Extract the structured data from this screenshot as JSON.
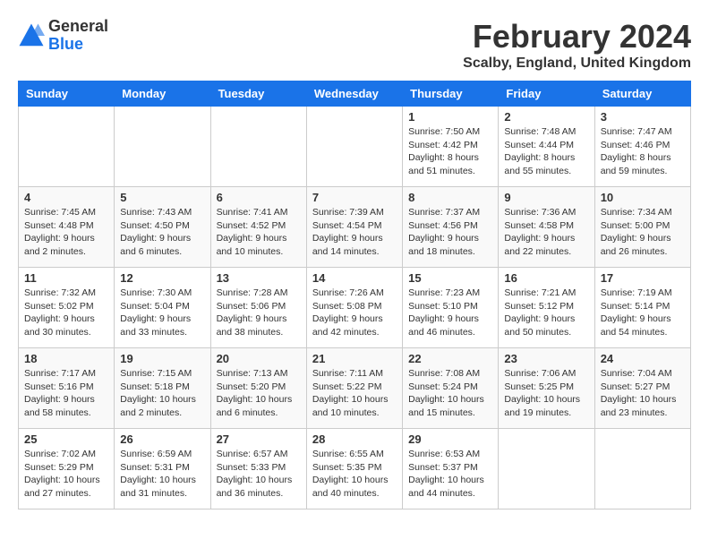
{
  "logo": {
    "general": "General",
    "blue": "Blue"
  },
  "title": "February 2024",
  "subtitle": "Scalby, England, United Kingdom",
  "days_of_week": [
    "Sunday",
    "Monday",
    "Tuesday",
    "Wednesday",
    "Thursday",
    "Friday",
    "Saturday"
  ],
  "weeks": [
    [
      {
        "day": "",
        "info": ""
      },
      {
        "day": "",
        "info": ""
      },
      {
        "day": "",
        "info": ""
      },
      {
        "day": "",
        "info": ""
      },
      {
        "day": "1",
        "info": "Sunrise: 7:50 AM\nSunset: 4:42 PM\nDaylight: 8 hours\nand 51 minutes."
      },
      {
        "day": "2",
        "info": "Sunrise: 7:48 AM\nSunset: 4:44 PM\nDaylight: 8 hours\nand 55 minutes."
      },
      {
        "day": "3",
        "info": "Sunrise: 7:47 AM\nSunset: 4:46 PM\nDaylight: 8 hours\nand 59 minutes."
      }
    ],
    [
      {
        "day": "4",
        "info": "Sunrise: 7:45 AM\nSunset: 4:48 PM\nDaylight: 9 hours\nand 2 minutes."
      },
      {
        "day": "5",
        "info": "Sunrise: 7:43 AM\nSunset: 4:50 PM\nDaylight: 9 hours\nand 6 minutes."
      },
      {
        "day": "6",
        "info": "Sunrise: 7:41 AM\nSunset: 4:52 PM\nDaylight: 9 hours\nand 10 minutes."
      },
      {
        "day": "7",
        "info": "Sunrise: 7:39 AM\nSunset: 4:54 PM\nDaylight: 9 hours\nand 14 minutes."
      },
      {
        "day": "8",
        "info": "Sunrise: 7:37 AM\nSunset: 4:56 PM\nDaylight: 9 hours\nand 18 minutes."
      },
      {
        "day": "9",
        "info": "Sunrise: 7:36 AM\nSunset: 4:58 PM\nDaylight: 9 hours\nand 22 minutes."
      },
      {
        "day": "10",
        "info": "Sunrise: 7:34 AM\nSunset: 5:00 PM\nDaylight: 9 hours\nand 26 minutes."
      }
    ],
    [
      {
        "day": "11",
        "info": "Sunrise: 7:32 AM\nSunset: 5:02 PM\nDaylight: 9 hours\nand 30 minutes."
      },
      {
        "day": "12",
        "info": "Sunrise: 7:30 AM\nSunset: 5:04 PM\nDaylight: 9 hours\nand 33 minutes."
      },
      {
        "day": "13",
        "info": "Sunrise: 7:28 AM\nSunset: 5:06 PM\nDaylight: 9 hours\nand 38 minutes."
      },
      {
        "day": "14",
        "info": "Sunrise: 7:26 AM\nSunset: 5:08 PM\nDaylight: 9 hours\nand 42 minutes."
      },
      {
        "day": "15",
        "info": "Sunrise: 7:23 AM\nSunset: 5:10 PM\nDaylight: 9 hours\nand 46 minutes."
      },
      {
        "day": "16",
        "info": "Sunrise: 7:21 AM\nSunset: 5:12 PM\nDaylight: 9 hours\nand 50 minutes."
      },
      {
        "day": "17",
        "info": "Sunrise: 7:19 AM\nSunset: 5:14 PM\nDaylight: 9 hours\nand 54 minutes."
      }
    ],
    [
      {
        "day": "18",
        "info": "Sunrise: 7:17 AM\nSunset: 5:16 PM\nDaylight: 9 hours\nand 58 minutes."
      },
      {
        "day": "19",
        "info": "Sunrise: 7:15 AM\nSunset: 5:18 PM\nDaylight: 10 hours\nand 2 minutes."
      },
      {
        "day": "20",
        "info": "Sunrise: 7:13 AM\nSunset: 5:20 PM\nDaylight: 10 hours\nand 6 minutes."
      },
      {
        "day": "21",
        "info": "Sunrise: 7:11 AM\nSunset: 5:22 PM\nDaylight: 10 hours\nand 10 minutes."
      },
      {
        "day": "22",
        "info": "Sunrise: 7:08 AM\nSunset: 5:24 PM\nDaylight: 10 hours\nand 15 minutes."
      },
      {
        "day": "23",
        "info": "Sunrise: 7:06 AM\nSunset: 5:25 PM\nDaylight: 10 hours\nand 19 minutes."
      },
      {
        "day": "24",
        "info": "Sunrise: 7:04 AM\nSunset: 5:27 PM\nDaylight: 10 hours\nand 23 minutes."
      }
    ],
    [
      {
        "day": "25",
        "info": "Sunrise: 7:02 AM\nSunset: 5:29 PM\nDaylight: 10 hours\nand 27 minutes."
      },
      {
        "day": "26",
        "info": "Sunrise: 6:59 AM\nSunset: 5:31 PM\nDaylight: 10 hours\nand 31 minutes."
      },
      {
        "day": "27",
        "info": "Sunrise: 6:57 AM\nSunset: 5:33 PM\nDaylight: 10 hours\nand 36 minutes."
      },
      {
        "day": "28",
        "info": "Sunrise: 6:55 AM\nSunset: 5:35 PM\nDaylight: 10 hours\nand 40 minutes."
      },
      {
        "day": "29",
        "info": "Sunrise: 6:53 AM\nSunset: 5:37 PM\nDaylight: 10 hours\nand 44 minutes."
      },
      {
        "day": "",
        "info": ""
      },
      {
        "day": "",
        "info": ""
      }
    ]
  ]
}
